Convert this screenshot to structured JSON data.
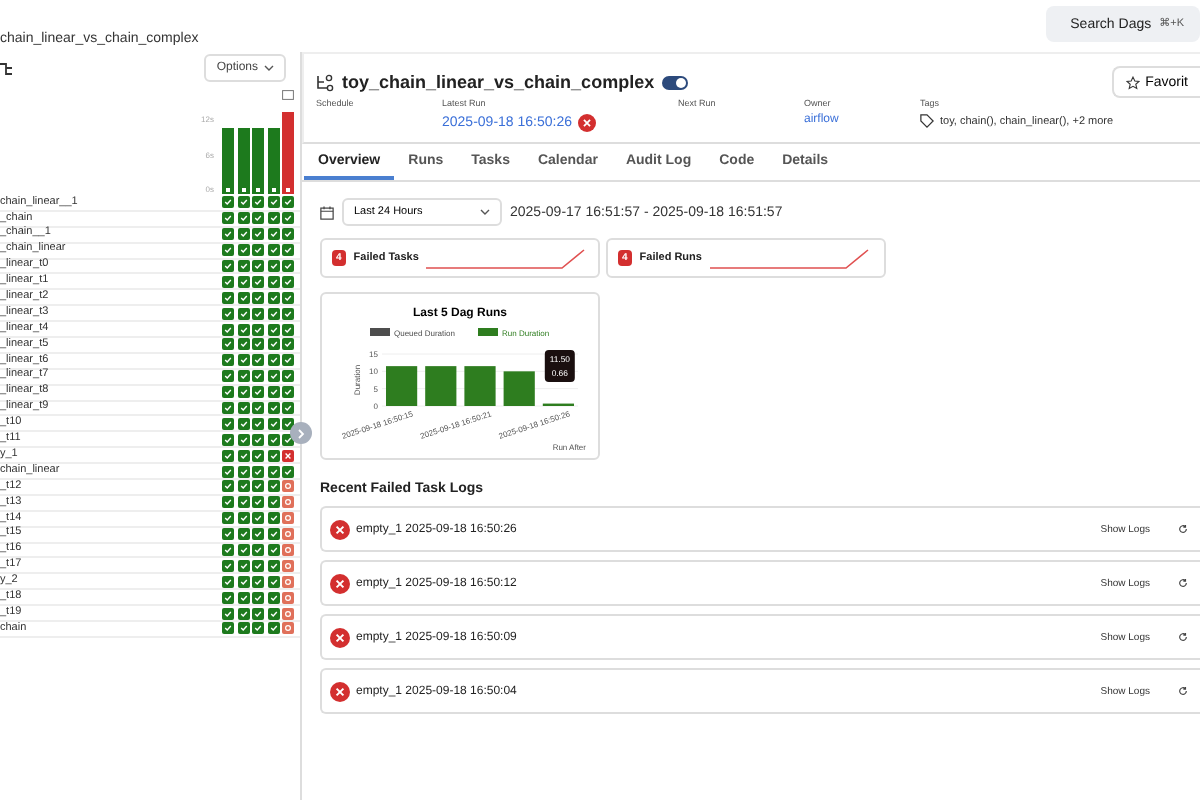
{
  "top_bar": {
    "breadcrumb": "chain_linear_vs_chain_complex",
    "search": {
      "label": "Search Dags",
      "shortcut": "⌘+K"
    }
  },
  "grid": {
    "options_label": "Options",
    "axis_labels": [
      "12s",
      "6s",
      "0s"
    ],
    "runs": [
      {
        "kind": "success"
      },
      {
        "kind": "success"
      },
      {
        "kind": "success"
      },
      {
        "kind": "success"
      },
      {
        "kind": "failed"
      }
    ],
    "rows": [
      {
        "name": "chain_linear__1",
        "cells": [
          {
            "kind": "success"
          },
          {
            "kind": "success"
          },
          {
            "kind": "success"
          },
          {
            "kind": "success"
          },
          {
            "kind": "success"
          }
        ]
      },
      {
        "name": "_chain",
        "cells": [
          {
            "kind": "success"
          },
          {
            "kind": "success"
          },
          {
            "kind": "success"
          },
          {
            "kind": "success"
          },
          {
            "kind": "success"
          }
        ]
      },
      {
        "name": "_chain__1",
        "cells": [
          {
            "kind": "success"
          },
          {
            "kind": "success"
          },
          {
            "kind": "success"
          },
          {
            "kind": "success"
          },
          {
            "kind": "success"
          }
        ]
      },
      {
        "name": "_chain_linear",
        "cells": [
          {
            "kind": "success"
          },
          {
            "kind": "success"
          },
          {
            "kind": "success"
          },
          {
            "kind": "success"
          },
          {
            "kind": "success"
          }
        ]
      },
      {
        "name": "_linear_t0",
        "cells": [
          {
            "kind": "success"
          },
          {
            "kind": "success"
          },
          {
            "kind": "success"
          },
          {
            "kind": "success"
          },
          {
            "kind": "success"
          }
        ]
      },
      {
        "name": "_linear_t1",
        "cells": [
          {
            "kind": "success"
          },
          {
            "kind": "success"
          },
          {
            "kind": "success"
          },
          {
            "kind": "success"
          },
          {
            "kind": "success"
          }
        ]
      },
      {
        "name": "_linear_t2",
        "cells": [
          {
            "kind": "success"
          },
          {
            "kind": "success"
          },
          {
            "kind": "success"
          },
          {
            "kind": "success"
          },
          {
            "kind": "success"
          }
        ]
      },
      {
        "name": "_linear_t3",
        "cells": [
          {
            "kind": "success"
          },
          {
            "kind": "success"
          },
          {
            "kind": "success"
          },
          {
            "kind": "success"
          },
          {
            "kind": "success"
          }
        ]
      },
      {
        "name": "_linear_t4",
        "cells": [
          {
            "kind": "success"
          },
          {
            "kind": "success"
          },
          {
            "kind": "success"
          },
          {
            "kind": "success"
          },
          {
            "kind": "success"
          }
        ]
      },
      {
        "name": "_linear_t5",
        "cells": [
          {
            "kind": "success"
          },
          {
            "kind": "success"
          },
          {
            "kind": "success"
          },
          {
            "kind": "success"
          },
          {
            "kind": "success"
          }
        ]
      },
      {
        "name": "_linear_t6",
        "cells": [
          {
            "kind": "success"
          },
          {
            "kind": "success"
          },
          {
            "kind": "success"
          },
          {
            "kind": "success"
          },
          {
            "kind": "success"
          }
        ]
      },
      {
        "name": "_linear_t7",
        "cells": [
          {
            "kind": "success"
          },
          {
            "kind": "success"
          },
          {
            "kind": "success"
          },
          {
            "kind": "success"
          },
          {
            "kind": "success"
          }
        ]
      },
      {
        "name": "_linear_t8",
        "cells": [
          {
            "kind": "success"
          },
          {
            "kind": "success"
          },
          {
            "kind": "success"
          },
          {
            "kind": "success"
          },
          {
            "kind": "success"
          }
        ]
      },
      {
        "name": "_linear_t9",
        "cells": [
          {
            "kind": "success"
          },
          {
            "kind": "success"
          },
          {
            "kind": "success"
          },
          {
            "kind": "success"
          },
          {
            "kind": "success"
          }
        ]
      },
      {
        "name": "_t10",
        "cells": [
          {
            "kind": "success"
          },
          {
            "kind": "success"
          },
          {
            "kind": "success"
          },
          {
            "kind": "success"
          },
          {
            "kind": "success"
          }
        ]
      },
      {
        "name": "_t11",
        "cells": [
          {
            "kind": "success"
          },
          {
            "kind": "success"
          },
          {
            "kind": "success"
          },
          {
            "kind": "success"
          },
          {
            "kind": "success"
          }
        ]
      },
      {
        "name": "y_1",
        "cells": [
          {
            "kind": "success"
          },
          {
            "kind": "success"
          },
          {
            "kind": "success"
          },
          {
            "kind": "success"
          },
          {
            "kind": "failed"
          }
        ]
      },
      {
        "name": "chain_linear",
        "cells": [
          {
            "kind": "success"
          },
          {
            "kind": "success"
          },
          {
            "kind": "success"
          },
          {
            "kind": "success"
          },
          {
            "kind": "success"
          }
        ]
      },
      {
        "name": "_t12",
        "cells": [
          {
            "kind": "success"
          },
          {
            "kind": "success"
          },
          {
            "kind": "success"
          },
          {
            "kind": "success"
          },
          {
            "kind": "upstream"
          }
        ]
      },
      {
        "name": "_t13",
        "cells": [
          {
            "kind": "success"
          },
          {
            "kind": "success"
          },
          {
            "kind": "success"
          },
          {
            "kind": "success"
          },
          {
            "kind": "upstream"
          }
        ]
      },
      {
        "name": "_t14",
        "cells": [
          {
            "kind": "success"
          },
          {
            "kind": "success"
          },
          {
            "kind": "success"
          },
          {
            "kind": "success"
          },
          {
            "kind": "upstream"
          }
        ]
      },
      {
        "name": "_t15",
        "cells": [
          {
            "kind": "success"
          },
          {
            "kind": "success"
          },
          {
            "kind": "success"
          },
          {
            "kind": "success"
          },
          {
            "kind": "upstream"
          }
        ]
      },
      {
        "name": "_t16",
        "cells": [
          {
            "kind": "success"
          },
          {
            "kind": "success"
          },
          {
            "kind": "success"
          },
          {
            "kind": "success"
          },
          {
            "kind": "upstream"
          }
        ]
      },
      {
        "name": "_t17",
        "cells": [
          {
            "kind": "success"
          },
          {
            "kind": "success"
          },
          {
            "kind": "success"
          },
          {
            "kind": "success"
          },
          {
            "kind": "upstream"
          }
        ]
      },
      {
        "name": "y_2",
        "cells": [
          {
            "kind": "success"
          },
          {
            "kind": "success"
          },
          {
            "kind": "success"
          },
          {
            "kind": "success"
          },
          {
            "kind": "upstream"
          }
        ]
      },
      {
        "name": "_t18",
        "cells": [
          {
            "kind": "success"
          },
          {
            "kind": "success"
          },
          {
            "kind": "success"
          },
          {
            "kind": "success"
          },
          {
            "kind": "upstream"
          }
        ]
      },
      {
        "name": "_t19",
        "cells": [
          {
            "kind": "success"
          },
          {
            "kind": "success"
          },
          {
            "kind": "success"
          },
          {
            "kind": "success"
          },
          {
            "kind": "upstream"
          }
        ]
      },
      {
        "name": "chain",
        "cells": [
          {
            "kind": "success"
          },
          {
            "kind": "success"
          },
          {
            "kind": "success"
          },
          {
            "kind": "success"
          },
          {
            "kind": "upstream"
          }
        ]
      }
    ]
  },
  "dag_header": {
    "title": "toy_chain_linear_vs_chain_complex",
    "active": true,
    "favorite_label": "Favorit",
    "fields": [
      {
        "label": "Schedule",
        "kind": "empty"
      },
      {
        "label": "Latest Run",
        "kind": "run",
        "value": "2025-09-18 16:50:26",
        "failed": true
      },
      {
        "label": "Next Run",
        "kind": "empty"
      },
      {
        "label": "Owner",
        "kind": "link",
        "value": "airflow"
      },
      {
        "label": "Tags",
        "kind": "tags",
        "value": "toy, chain(), chain_linear(), +2 more"
      }
    ]
  },
  "tabs": [
    {
      "label": "Overview",
      "selected": true
    },
    {
      "label": "Runs",
      "selected": false
    },
    {
      "label": "Tasks",
      "selected": false
    },
    {
      "label": "Calendar",
      "selected": false
    },
    {
      "label": "Audit Log",
      "selected": false
    },
    {
      "label": "Code",
      "selected": false
    },
    {
      "label": "Details",
      "selected": false
    }
  ],
  "overview": {
    "range_select": "Last 24 Hours",
    "range_text": "2025-09-17 16:51:57 - 2025-09-18 16:51:57",
    "stats": [
      {
        "count": "4",
        "label": "Failed Tasks"
      },
      {
        "count": "4",
        "label": "Failed Runs"
      }
    ],
    "chart": {
      "chart_data": {
        "type": "bar",
        "title": "Last 5 Dag Runs",
        "xlabel": "Run After",
        "ylabel": "Duration",
        "categories": [
          "2025-09-18 16:50:15",
          null,
          "2025-09-18 16:50:21",
          null,
          "2025-09-18 16:50:26"
        ],
        "yticks": [
          0,
          5,
          10,
          15
        ],
        "ylim": [
          0,
          15
        ],
        "stacked": true,
        "series": [
          {
            "name": "Queued Duration",
            "color": "#4d4d4d",
            "values": [
              0,
              0,
              0,
              0,
              0
            ]
          },
          {
            "name": "Run Duration",
            "color": "#2e7d1f",
            "values": [
              11.5,
              11.5,
              11.5,
              10,
              0.7
            ]
          }
        ],
        "annotations": [
          "11.50",
          "0.66"
        ]
      }
    },
    "logs_title": "Recent Failed Task Logs",
    "logs": [
      {
        "text": "empty_1 2025-09-18 16:50:26",
        "action": "Show Logs"
      },
      {
        "text": "empty_1 2025-09-18 16:50:12",
        "action": "Show Logs"
      },
      {
        "text": "empty_1 2025-09-18 16:50:09",
        "action": "Show Logs"
      },
      {
        "text": "empty_1 2025-09-18 16:50:04",
        "action": "Show Logs"
      }
    ]
  }
}
